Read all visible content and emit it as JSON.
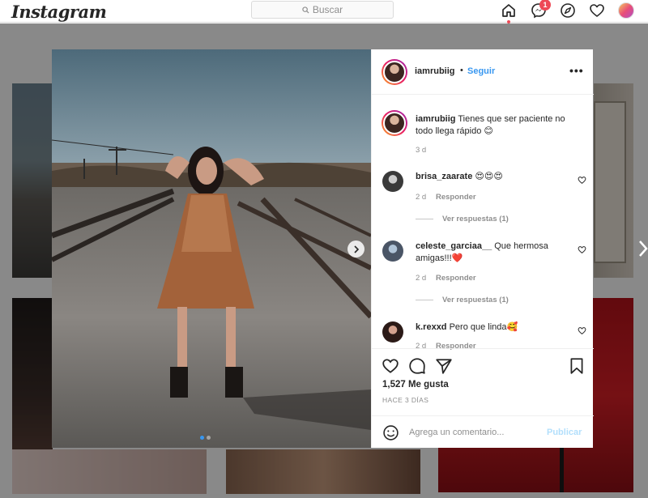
{
  "app": {
    "logo": "Instagram"
  },
  "search": {
    "placeholder": "Buscar"
  },
  "nav": {
    "notification_count": "1"
  },
  "post": {
    "username": "iamrubiig",
    "separator": "•",
    "follow_label": "Seguir",
    "more_label": "•••",
    "caption": {
      "username": "iamrubiig",
      "text": "Tienes que ser paciente no todo llega rápido 😊",
      "age": "3 d"
    },
    "comments": [
      {
        "username": "brisa_zaarate",
        "text": "😍😍😍",
        "age": "2 d",
        "reply": "Responder",
        "view_replies": "Ver respuestas (1)"
      },
      {
        "username": "celeste_garciaa__",
        "text": "Que hermosa amigas!!!❤️",
        "age": "2 d",
        "reply": "Responder",
        "view_replies": "Ver respuestas (1)"
      },
      {
        "username": "k.rexxd",
        "text": "Pero que linda🥰",
        "age": "2 d",
        "reply": "Responder"
      }
    ],
    "likes": "1,527 Me gusta",
    "posted": "HACE 3 DÍAS",
    "comment_placeholder": "Agrega un comentario...",
    "publish_label": "Publicar"
  },
  "colors": {
    "accent": "#3897f0",
    "notification": "#ed4956",
    "publish_disabled": "#b2dffc"
  },
  "icons": [
    "search-icon",
    "home-icon",
    "messenger-icon",
    "explore-icon",
    "heart-icon",
    "more-icon",
    "chevron-right-icon",
    "comment-icon",
    "share-icon",
    "bookmark-icon",
    "emoji-icon"
  ]
}
